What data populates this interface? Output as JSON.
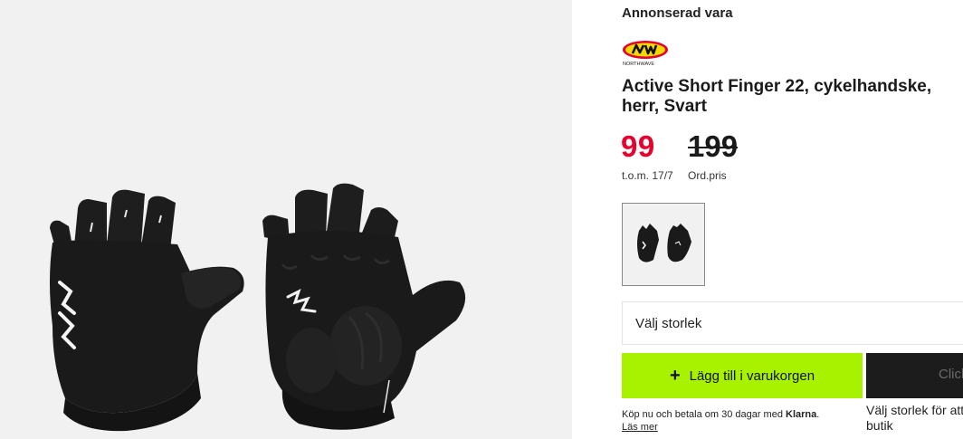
{
  "product": {
    "sponsored_label": "Annonserad vara",
    "brand": "Northwave",
    "brand_logo_text": "NW",
    "brand_logo_subtext": "NORTHWAVE",
    "title": "Active Short Finger 22, cykelhandske, herr, Svart",
    "price_now": "99",
    "price_old": "199",
    "valid_until": "t.o.m. 17/7",
    "old_price_label": "Ord.pris",
    "colors": {
      "sale_price": "#e4032e",
      "add_button": "#a8f200",
      "dark_button": "#1c1c1c"
    }
  },
  "size_select": {
    "placeholder": "Välj storlek"
  },
  "actions": {
    "add_to_cart": "Lägg till i varukorgen",
    "add_icon": "plus-icon",
    "click_collect": "Click & Collect"
  },
  "notes": {
    "klarna_prefix": "Köp nu och betala om 30 dagar med ",
    "klarna_brand": "Klarna",
    "klarna_suffix": ".",
    "klarna_link": "Läs mer",
    "store_note_line1": "Välj storlek för att",
    "store_note_line2": "butik"
  }
}
